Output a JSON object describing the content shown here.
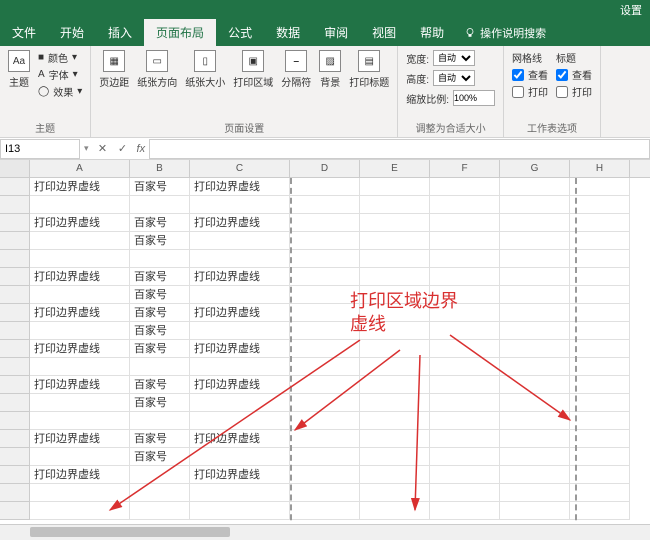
{
  "titlebar": {
    "settings": "设置"
  },
  "tabs": {
    "file": "文件",
    "home": "开始",
    "insert": "插入",
    "layout": "页面布局",
    "formulas": "公式",
    "data": "数据",
    "review": "审阅",
    "view": "视图",
    "help": "帮助",
    "tellme": "操作说明搜索"
  },
  "ribbon": {
    "theme_group": {
      "label": "主题",
      "theme": "主题",
      "color": "颜色",
      "font": "字体",
      "effect": "效果"
    },
    "page_setup": {
      "label": "页面设置",
      "margins": "页边距",
      "orientation": "纸张方向",
      "size": "纸张大小",
      "print_area": "打印区域",
      "breaks": "分隔符",
      "background": "背景",
      "print_titles": "打印标题"
    },
    "scale": {
      "label": "调整为合适大小",
      "width_lbl": "宽度:",
      "width_val": "自动",
      "height_lbl": "高度:",
      "height_val": "自动",
      "scale_lbl": "缩放比例:",
      "scale_val": "100%"
    },
    "sheet_options": {
      "label": "工作表选项",
      "gridlines": "网格线",
      "headings": "标题",
      "view": "查看",
      "print": "打印"
    }
  },
  "namebox": "I13",
  "columns": [
    "A",
    "B",
    "C",
    "D",
    "E",
    "F",
    "G",
    "H"
  ],
  "rows_data": [
    {
      "a": "打印边界虚线",
      "b": "百家号",
      "c": "打印边界虚线"
    },
    {
      "a": "",
      "b": "",
      "c": ""
    },
    {
      "a": "打印边界虚线",
      "b": "百家号",
      "c": "打印边界虚线"
    },
    {
      "a": "",
      "b": "百家号",
      "c": ""
    },
    {
      "a": "",
      "b": "",
      "c": ""
    },
    {
      "a": "打印边界虚线",
      "b": "百家号",
      "c": "打印边界虚线"
    },
    {
      "a": "",
      "b": "百家号",
      "c": ""
    },
    {
      "a": "打印边界虚线",
      "b": "百家号",
      "c": "打印边界虚线"
    },
    {
      "a": "",
      "b": "百家号",
      "c": ""
    },
    {
      "a": "打印边界虚线",
      "b": "百家号",
      "c": "打印边界虚线"
    },
    {
      "a": "",
      "b": "",
      "c": ""
    },
    {
      "a": "打印边界虚线",
      "b": "百家号",
      "c": "打印边界虚线"
    },
    {
      "a": "",
      "b": "百家号",
      "c": ""
    },
    {
      "a": "",
      "b": "",
      "c": ""
    },
    {
      "a": "打印边界虚线",
      "b": "百家号",
      "c": "打印边界虚线"
    },
    {
      "a": "",
      "b": "百家号",
      "c": ""
    },
    {
      "a": "打印边界虚线",
      "b": "",
      "c": "打印边界虚线"
    },
    {
      "a": "",
      "b": "",
      "c": ""
    },
    {
      "a": "",
      "b": "",
      "c": ""
    }
  ],
  "annotation": {
    "line1": "打印区域边界",
    "line2": "虚线"
  }
}
